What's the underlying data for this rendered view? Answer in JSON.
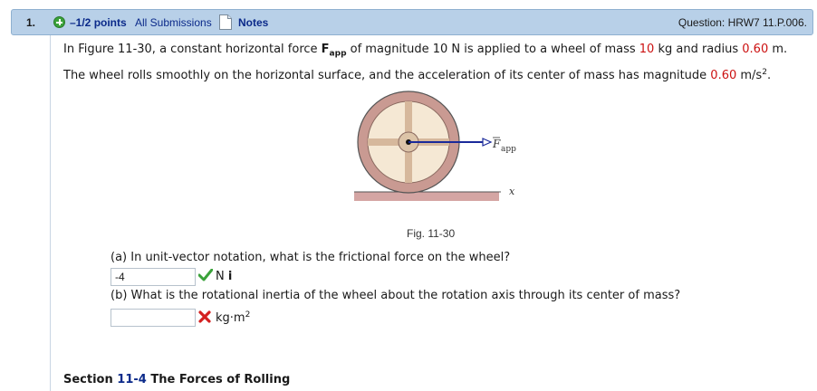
{
  "header": {
    "question_number": "1.",
    "points_label": "–1/2 points",
    "all_submissions_label": "All Submissions",
    "notes_label": "Notes",
    "question_id": "Question: HRW7 11.P.006."
  },
  "problem": {
    "line1_a": "In Figure 11-30, a constant horizontal force ",
    "force_symbol": "F",
    "force_subscript": "app",
    "line1_b": " of magnitude 10 N is applied to a wheel of mass ",
    "mass_value": "10",
    "line1_c": " kg and radius ",
    "radius_value": "0.60",
    "line1_d": " m.",
    "line2_a": "The wheel rolls smoothly on the horizontal surface, and the acceleration of its center of mass has magnitude ",
    "accel_value": "0.60",
    "line2_b": " m/s",
    "line2_sup": "2",
    "line2_c": "."
  },
  "figure": {
    "caption": "Fig. 11-30",
    "force_label": "F",
    "force_label_sub": "app",
    "axis_label": "x"
  },
  "part_a": {
    "question": "(a) In unit-vector notation, what is the frictional force on the wheel?",
    "answer_value": "-4",
    "unit_text": "N",
    "unit_vector": "i",
    "status": "correct"
  },
  "part_b": {
    "question": "(b) What is the rotational inertia of the wheel about the rotation axis through its center of mass?",
    "answer_value": "",
    "unit_text": "kg·m",
    "unit_sup": "2",
    "status": "incorrect"
  },
  "section": {
    "label": "Section ",
    "number": "11-4",
    "title": " The Forces of Rolling"
  },
  "colors": {
    "header_bg": "#b8d0e8",
    "link": "#0b2a8a",
    "value_red": "#cc1111",
    "check_green": "#3aa23a",
    "x_red": "#d42020"
  }
}
